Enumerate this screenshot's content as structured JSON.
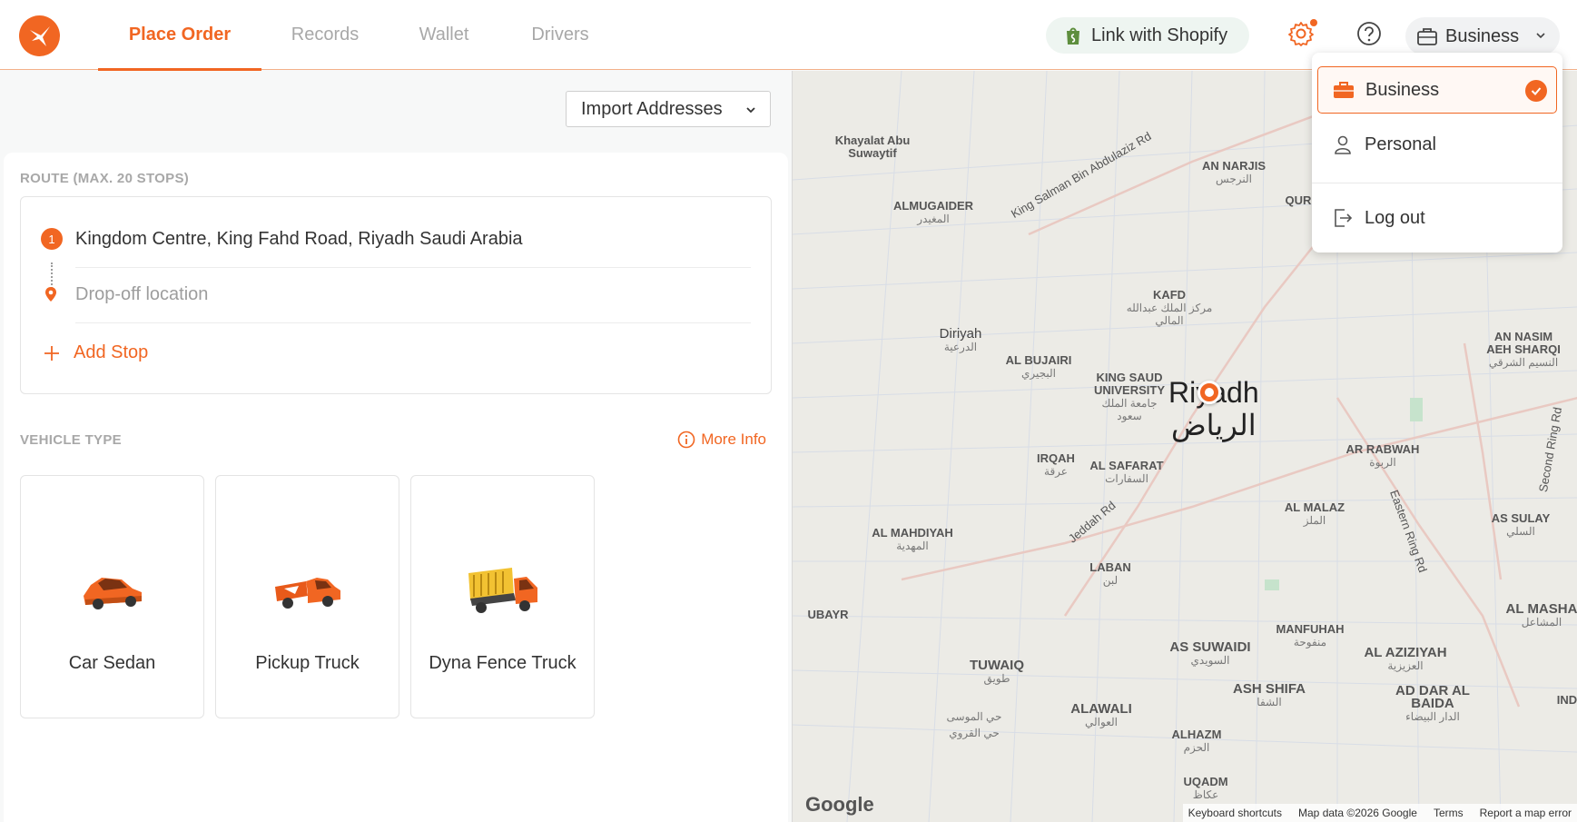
{
  "header": {
    "tabs": [
      {
        "label": "Place Order",
        "active": true
      },
      {
        "label": "Records",
        "active": false
      },
      {
        "label": "Wallet",
        "active": false
      },
      {
        "label": "Drivers",
        "active": false
      }
    ],
    "shopify_label": "Link with Shopify",
    "account_label": "Business"
  },
  "left": {
    "import_label": "Import Addresses",
    "route_label": "ROUTE (MAX. 20 STOPS)",
    "stop_number": "1",
    "pickup_value": "Kingdom Centre, King Fahd Road, Riyadh Saudi Arabia",
    "dropoff_placeholder": "Drop-off location",
    "add_stop_label": "Add Stop",
    "vehicle_label": "VEHICLE TYPE",
    "more_info_label": "More Info",
    "vehicles": [
      {
        "label": "Car Sedan",
        "icon": "car-sedan-icon"
      },
      {
        "label": "Pickup Truck",
        "icon": "pickup-truck-icon"
      },
      {
        "label": "Dyna Fence Truck",
        "icon": "dyna-fence-truck-icon"
      }
    ]
  },
  "map": {
    "city_en": "Riyadh",
    "city_ar": "الرياض",
    "google_logo": "Google",
    "footer": [
      "Keyboard shortcuts",
      "Map data ©2026 Google",
      "Terms",
      "Report a map error"
    ],
    "labels": [
      {
        "en": "Khayalat Abu Suwaytif",
        "ar": ""
      },
      {
        "en": "ALMUGAIDER",
        "ar": "المغيدر"
      },
      {
        "en": "King Salman Bin Abdulaziz Rd",
        "ar": ""
      },
      {
        "en": "AN NARJIS",
        "ar": "النرجس"
      },
      {
        "en": "QUR",
        "ar": ""
      },
      {
        "en": "KAFD",
        "ar": "مركز الملك عبدالله المالي"
      },
      {
        "en": "Diriyah",
        "ar": "الدرعية"
      },
      {
        "en": "AL BUJAIRI",
        "ar": "البجيري"
      },
      {
        "en": "KING SAUD UNIVERSITY",
        "ar": "جامعة الملك سعود"
      },
      {
        "en": "AN NASIM AEH SHARQI",
        "ar": "النسيم الشرقي"
      },
      {
        "en": "IRQAH",
        "ar": "عرقة"
      },
      {
        "en": "AL SAFARAT",
        "ar": "السفارات"
      },
      {
        "en": "AR RABWAH",
        "ar": "الربوة"
      },
      {
        "en": "Second Ring Rd",
        "ar": ""
      },
      {
        "en": "Jeddah Rd",
        "ar": ""
      },
      {
        "en": "AL MALAZ",
        "ar": "الملز"
      },
      {
        "en": "Eastern Ring Rd",
        "ar": ""
      },
      {
        "en": "AS SULAY",
        "ar": "السلي"
      },
      {
        "en": "AL MAHDIYAH",
        "ar": "المهدية"
      },
      {
        "en": "LABAN",
        "ar": "لبن"
      },
      {
        "en": "UBAYR",
        "ar": ""
      },
      {
        "en": "MANFUHAH",
        "ar": "منفوحة"
      },
      {
        "en": "AL MASHA",
        "ar": "المشاعل"
      },
      {
        "en": "AS SUWAIDI",
        "ar": "السويدي"
      },
      {
        "en": "AL AZIZIYAH",
        "ar": "العزيزية"
      },
      {
        "en": "TUWAIQ",
        "ar": "طويق"
      },
      {
        "en": "ASH SHIFA",
        "ar": "الشفا"
      },
      {
        "en": "AD DAR AL BAIDA",
        "ar": "الدار البيضاء"
      },
      {
        "en": "ALAWALI",
        "ar": "العوالي"
      },
      {
        "en": "ALHAZM",
        "ar": "الحزم"
      },
      {
        "en": "",
        "ar": "حي الموسى"
      },
      {
        "en": "",
        "ar": "حي القروي"
      },
      {
        "en": "UQADM",
        "ar": "عكاظ"
      },
      {
        "en": "IND",
        "ar": ""
      }
    ]
  },
  "account_menu": {
    "items": [
      {
        "label": "Business",
        "selected": true
      },
      {
        "label": "Personal",
        "selected": false
      },
      {
        "label": "Log out",
        "selected": false
      }
    ]
  },
  "colors": {
    "brand": "#f16622",
    "shopify_green": "#5e8e3e"
  }
}
